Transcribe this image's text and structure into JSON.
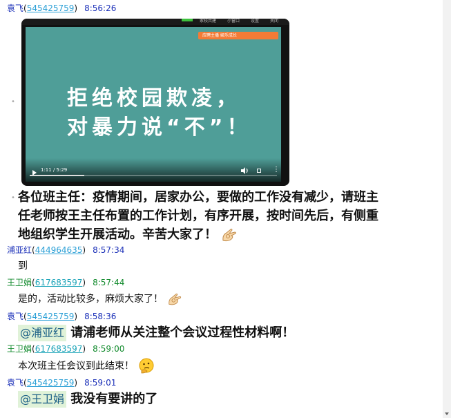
{
  "messages": [
    {
      "sender": "袁飞",
      "qq": "545425759",
      "time": "8:56:26"
    },
    {
      "text": "各位班主任：疫情期间，居家办公，要做的工作没有减少，请班主",
      "text2": "任老师按王主任布置的工作计划，有序开展，按时间先后，有侧重",
      "text3": "地组织学生开展活动。辛苦大家了！"
    },
    {
      "sender": "浦亚红",
      "qq": "444964635",
      "time": "8:57:34",
      "text": "到"
    },
    {
      "sender": "王卫娟",
      "qq": "617683597",
      "time": "8:57:44",
      "text": "是的，活动比较多，麻烦大家了！"
    },
    {
      "sender": "袁飞",
      "qq": "545425759",
      "time": "8:58:36",
      "mention": "@浦亚红",
      "text": "请浦老师从关注整个会议过程性材料啊！"
    },
    {
      "sender": "王卫娟",
      "qq": "617683597",
      "time": "8:59:00",
      "text": "本次班主任会议到此结束！"
    },
    {
      "sender": "袁飞",
      "qq": "545425759",
      "time": "8:59:01",
      "mention": "@王卫娟",
      "text": "我没有要讲的了"
    }
  ],
  "video": {
    "title_line1": "拒绝校园欺凌，",
    "title_line2": "对暴力说“不”！",
    "banner": "应聘主播  娱乐成长",
    "top_tabs": [
      "家校共建",
      "小窗口",
      "设置",
      "关闭"
    ],
    "time_display": "1:11 / 5:29",
    "progress": 0.22
  },
  "icons": {
    "emoji1": "ok-hand-icon",
    "emoji2": "thinking-face-icon"
  }
}
